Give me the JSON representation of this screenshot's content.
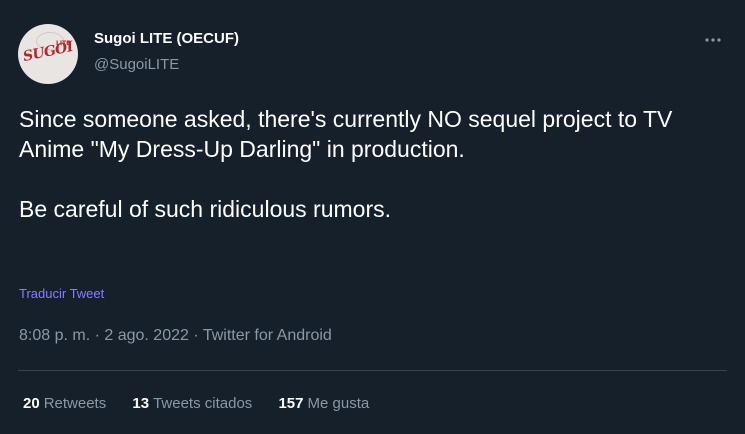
{
  "author": {
    "display_name": "Sugoi LITE (OECUF)",
    "handle": "@SugoiLITE",
    "avatar_text": "SUGOI",
    "avatar_subtext": "LITE"
  },
  "tweet": {
    "lines": [
      "Since someone asked, there's currently NO sequel project to TV Anime \"My Dress-Up Darling\" in production.",
      "Be careful of such ridiculous rumors."
    ],
    "translate_label": "Traducir Tweet",
    "time": "8:08 p. m.",
    "separator1": " · ",
    "date": "2 ago. 2022",
    "separator2": " · ",
    "source": "Twitter for Android"
  },
  "stats": {
    "retweets_count": "20",
    "retweets_label": "Retweets",
    "quotes_count": "13",
    "quotes_label": "Tweets citados",
    "likes_count": "157",
    "likes_label": "Me gusta"
  },
  "colors": {
    "background": "#15202b",
    "text": "#ffffff",
    "secondary": "#8b98a5",
    "link": "#8a7cff",
    "divider": "#38444d"
  },
  "icons": {
    "more": "more-horizontal-icon"
  }
}
